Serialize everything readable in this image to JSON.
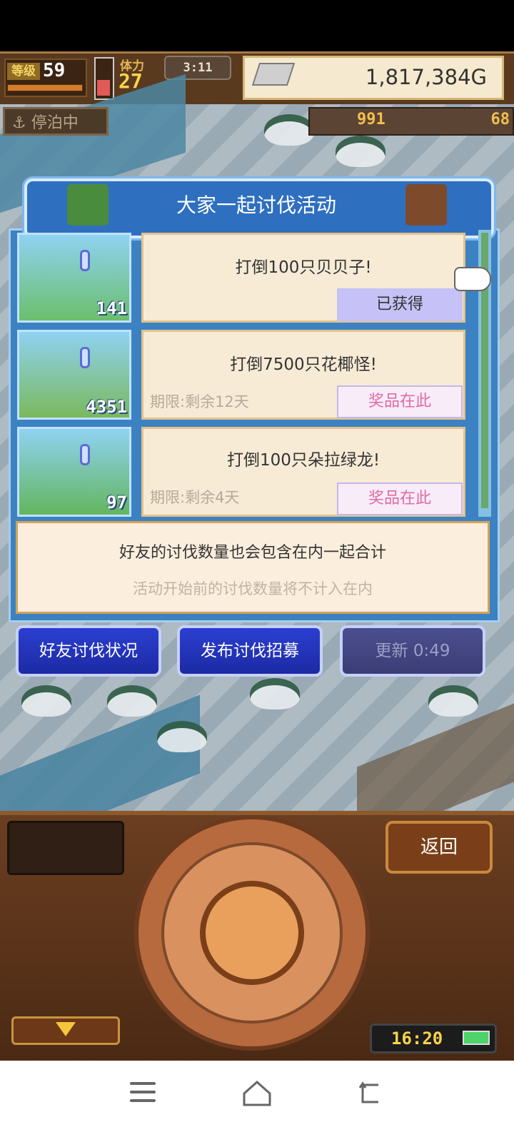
{
  "hud": {
    "level_label": "等级",
    "level_value": "59",
    "stamina_label": "体力",
    "stamina_value": "27",
    "clock": "3:11",
    "money": "1,817,384G"
  },
  "map": {
    "harbor_status": "停泊中",
    "wood_count": "991",
    "coin_count": "68"
  },
  "event": {
    "title": "大家一起讨伐活动",
    "quests": [
      {
        "title": "打倒100只贝贝子!",
        "count": "141",
        "deadline": "",
        "status_label": "已获得",
        "status_type": "claimed"
      },
      {
        "title": "打倒7500只花椰怪!",
        "count": "4351",
        "deadline": "期限:剩余12天",
        "status_label": "奖品在此",
        "status_type": "prize"
      },
      {
        "title": "打倒100只朵拉绿龙!",
        "count": "97",
        "deadline": "期限:剩余4天",
        "status_label": "奖品在此",
        "status_type": "prize"
      }
    ],
    "info_main": "好友的讨伐数量也会包含在内一起合计",
    "info_sub": "活动开始前的讨伐数量将不计入在内",
    "buttons": {
      "friend_status": "好友讨伐状况",
      "publish_recruit": "发布讨伐招募",
      "refresh": "更新 0:49"
    }
  },
  "controller": {
    "back_label": "返回",
    "game_time": "16:20"
  },
  "colors": {
    "panel_blue": "#3c82c2",
    "button_blue": "#2b3fd1",
    "prize_pink": "#e06aa3",
    "claimed_purple": "#c6c1f6"
  }
}
